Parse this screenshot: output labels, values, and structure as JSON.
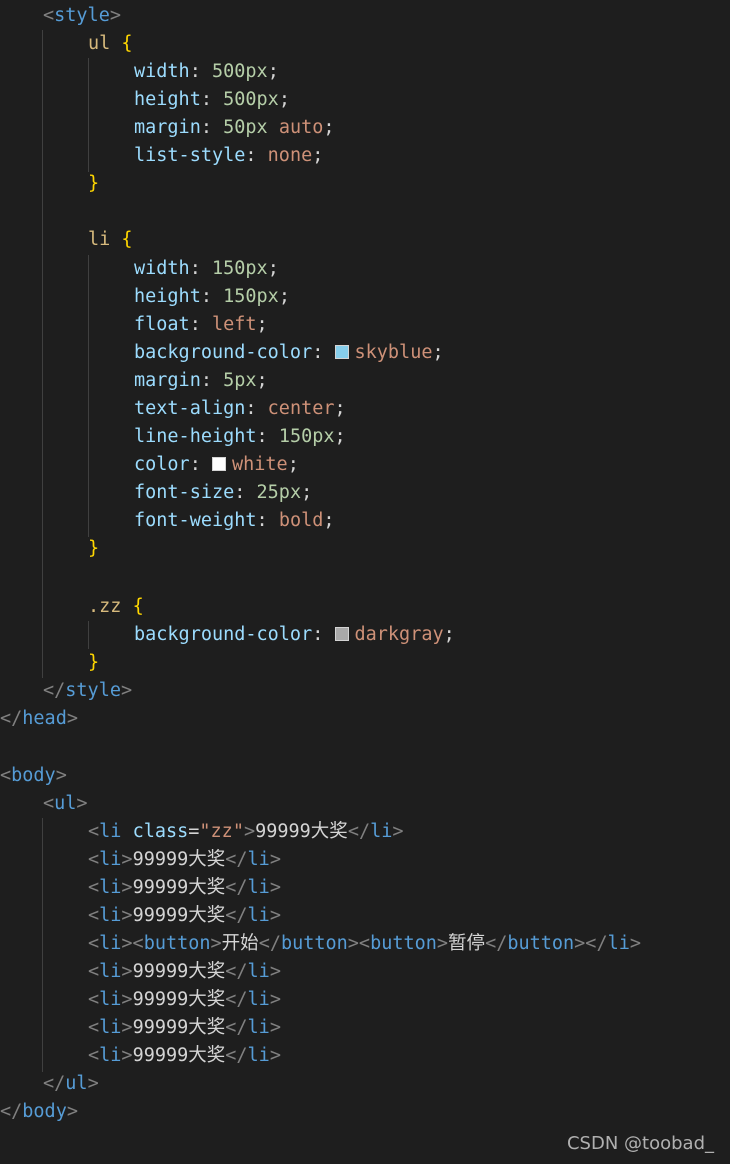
{
  "code": {
    "style_open": "style",
    "ul_selector": "ul",
    "ul_props": [
      {
        "prop": "width",
        "value": "500px"
      },
      {
        "prop": "height",
        "value": "500px"
      },
      {
        "prop": "margin",
        "value": "50px",
        "value2": "auto"
      },
      {
        "prop": "list-style",
        "value": "none"
      }
    ],
    "li_selector": "li",
    "li_props": [
      {
        "prop": "width",
        "value": "150px"
      },
      {
        "prop": "height",
        "value": "150px"
      },
      {
        "prop": "float",
        "value": "left"
      },
      {
        "prop": "background-color",
        "value": "skyblue",
        "swatch": "#87ceeb"
      },
      {
        "prop": "margin",
        "value": "5px"
      },
      {
        "prop": "text-align",
        "value": "center"
      },
      {
        "prop": "line-height",
        "value": "150px"
      },
      {
        "prop": "color",
        "value": "white",
        "swatch": "#ffffff"
      },
      {
        "prop": "font-size",
        "value": "25px"
      },
      {
        "prop": "font-weight",
        "value": "bold"
      }
    ],
    "zz_selector": ".zz",
    "zz_props": [
      {
        "prop": "background-color",
        "value": "darkgray",
        "swatch": "#a9a9a9"
      }
    ],
    "style_close": "style",
    "head_close": "head",
    "body_open": "body",
    "ul_open": "ul",
    "li_tag": "li",
    "class_attr": "class",
    "class_value": "\"zz\"",
    "prize_text": "99999大奖",
    "button_tag": "button",
    "start_label": "开始",
    "pause_label": "暂停",
    "ul_close": "ul",
    "body_close": "body"
  },
  "watermark": "CSDN @toobad_"
}
